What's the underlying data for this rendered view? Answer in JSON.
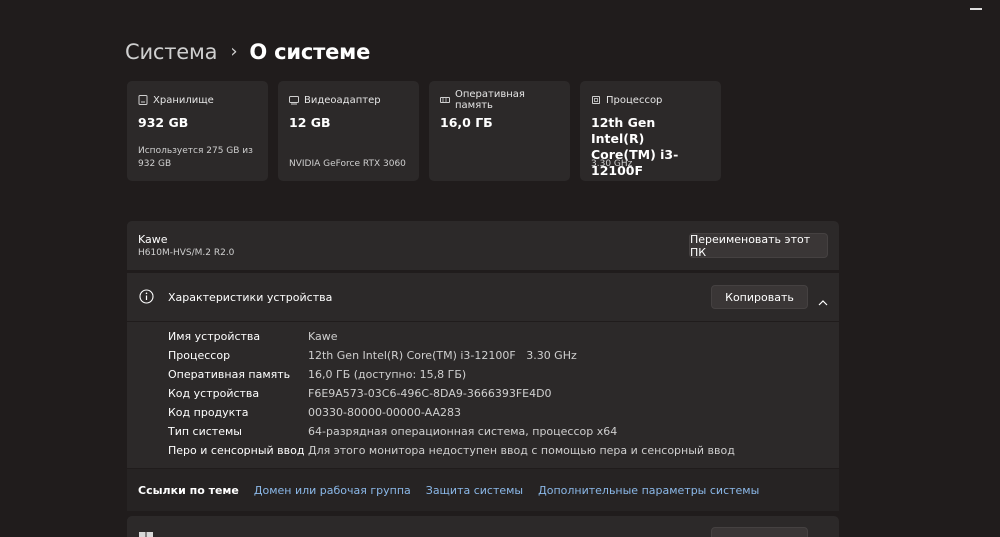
{
  "breadcrumb": {
    "parent": "Система",
    "separator": "›",
    "current": "О системе"
  },
  "cards": [
    {
      "icon": "storage-icon",
      "label": "Хранилище",
      "value": "932 GB",
      "sub": "Используется 275 GB из 932 GB"
    },
    {
      "icon": "gpu-icon",
      "label": "Видеоадаптер",
      "value": "12 GB",
      "sub": "NVIDIA GeForce RTX 3060"
    },
    {
      "icon": "ram-icon",
      "label": "Оперативная память",
      "value": "16,0 ГБ",
      "sub": ""
    },
    {
      "icon": "cpu-icon",
      "label": "Процессор",
      "value": "12th Gen Intel(R) Core(TM) i3-12100F",
      "sub": "3.30 GHz"
    }
  ],
  "device": {
    "name": "Kawe",
    "model": "H610M-HVS/M.2 R2.0",
    "rename_label": "Переименовать этот ПК"
  },
  "specs": {
    "title": "Характеристики устройства",
    "copy_label": "Копировать",
    "rows": [
      {
        "label": "Имя устройства",
        "value": "Kawe"
      },
      {
        "label": "Процессор",
        "value": "12th Gen Intel(R) Core(TM) i3-12100F   3.30 GHz"
      },
      {
        "label": "Оперативная память",
        "value": "16,0 ГБ (доступно: 15,8 ГБ)"
      },
      {
        "label": "Код устройства",
        "value": "F6E9A573-03C6-496C-8DA9-3666393FE4D0"
      },
      {
        "label": "Код продукта",
        "value": "00330-80000-00000-AA283"
      },
      {
        "label": "Тип системы",
        "value": "64-разрядная операционная система, процессор x64"
      },
      {
        "label": "Перо и сенсорный ввод",
        "value": "Для этого монитора недоступен ввод с помощью пера и сенсорный ввод"
      }
    ]
  },
  "related": {
    "title": "Ссылки по теме",
    "links": [
      "Домен или рабочая группа",
      "Защита системы",
      "Дополнительные параметры системы"
    ]
  },
  "colors": {
    "background": "#201c1c",
    "card": "#2c2929",
    "link": "#8bb8e8",
    "text_secondary": "#cfcfcf"
  }
}
